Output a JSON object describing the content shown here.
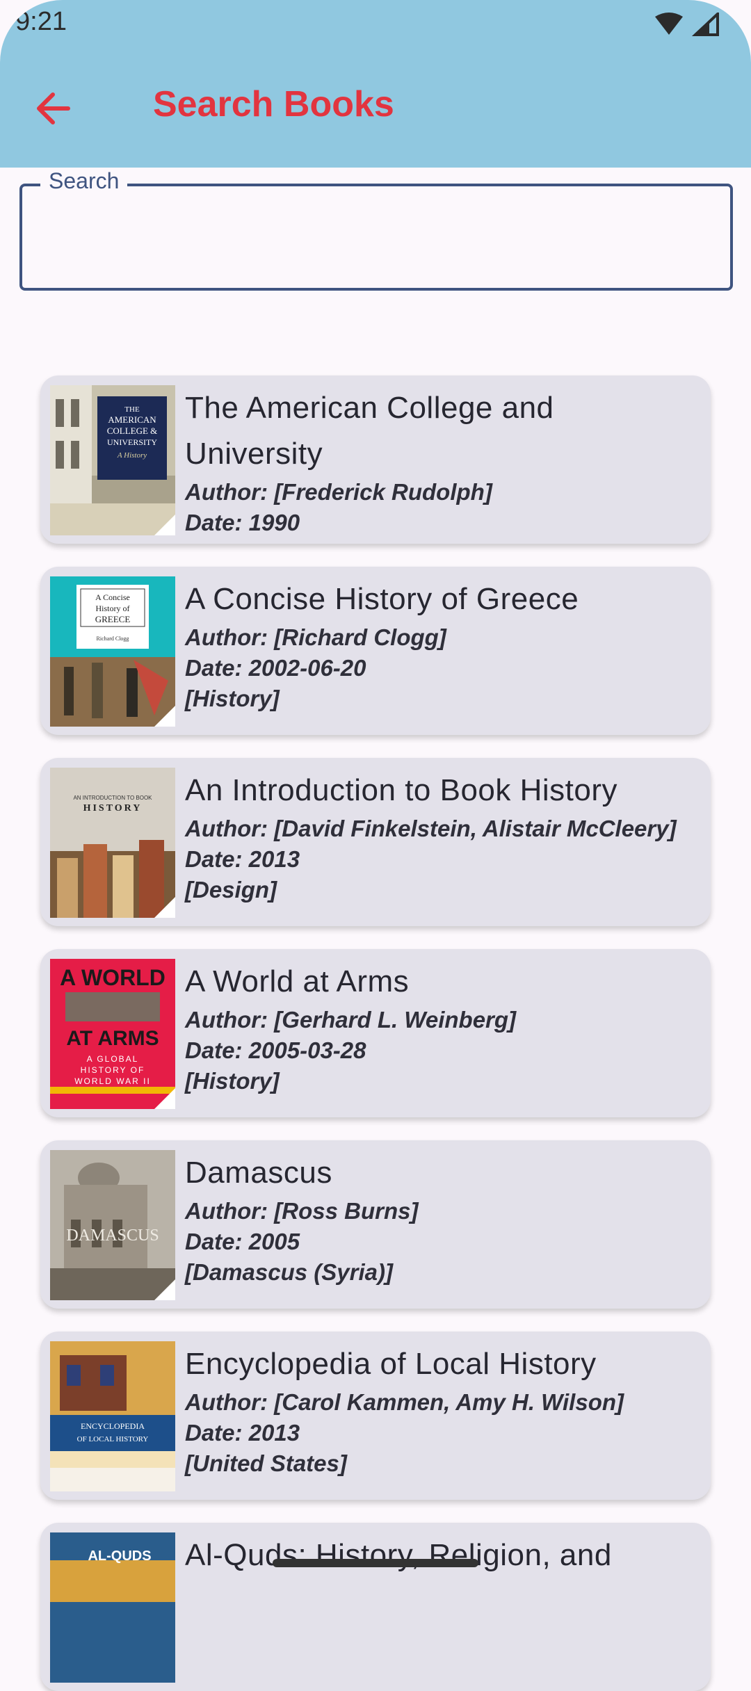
{
  "status": {
    "time": "9:21"
  },
  "header": {
    "title": "Search Books"
  },
  "search": {
    "label": "Search",
    "value": ""
  },
  "books": [
    {
      "title": "The American College and University",
      "author": "Author: [Frederick Rudolph]",
      "date": "Date: 1990",
      "subject": ""
    },
    {
      "title": "A Concise History of Greece",
      "author": "Author: [Richard Clogg]",
      "date": "Date: 2002-06-20",
      "subject": "[History]"
    },
    {
      "title": "An Introduction to Book History",
      "author": "Author: [David Finkelstein, Alistair McCleery]",
      "date": "Date: 2013",
      "subject": "[Design]"
    },
    {
      "title": "A World at Arms",
      "author": "Author: [Gerhard L. Weinberg]",
      "date": "Date: 2005-03-28",
      "subject": "[History]"
    },
    {
      "title": "Damascus",
      "author": "Author: [Ross Burns]",
      "date": "Date: 2005",
      "subject": "[Damascus (Syria)]"
    },
    {
      "title": "Encyclopedia of Local History",
      "author": "Author: [Carol Kammen, Amy H. Wilson]",
      "date": "Date: 2013",
      "subject": "[United States]"
    },
    {
      "title": "Al-Quds: History, Religion, and",
      "author": "",
      "date": "",
      "subject": ""
    }
  ],
  "covers": {
    "c1": {
      "line1": "THE",
      "line2": "AMERICAN",
      "line3": "COLLEGE &",
      "line4": "UNIVERSITY",
      "line5": "A History"
    },
    "c2": {
      "line1": "A Concise",
      "line2": "History of",
      "line3": "GREECE",
      "line4": "Richard Clogg"
    },
    "c3": {
      "line1": "AN INTRODUCTION TO BOOK",
      "line2": "HISTORY"
    },
    "c4": {
      "line1": "A WORLD",
      "line2": "AT ARMS",
      "line3": "A GLOBAL",
      "line4": "HISTORY OF",
      "line5": "WORLD WAR II"
    },
    "c5": {
      "line1": "DAMASCUS"
    },
    "c6": {
      "line1": "ENCYCLOPEDIA",
      "line2": "OF LOCAL HISTORY"
    },
    "c7": {
      "line1": "AL-QUDS"
    }
  },
  "colors": {
    "appbar": "#90c8e0",
    "accent": "#e2343f",
    "card": "#e3e1ea",
    "outline": "#3f5480"
  }
}
